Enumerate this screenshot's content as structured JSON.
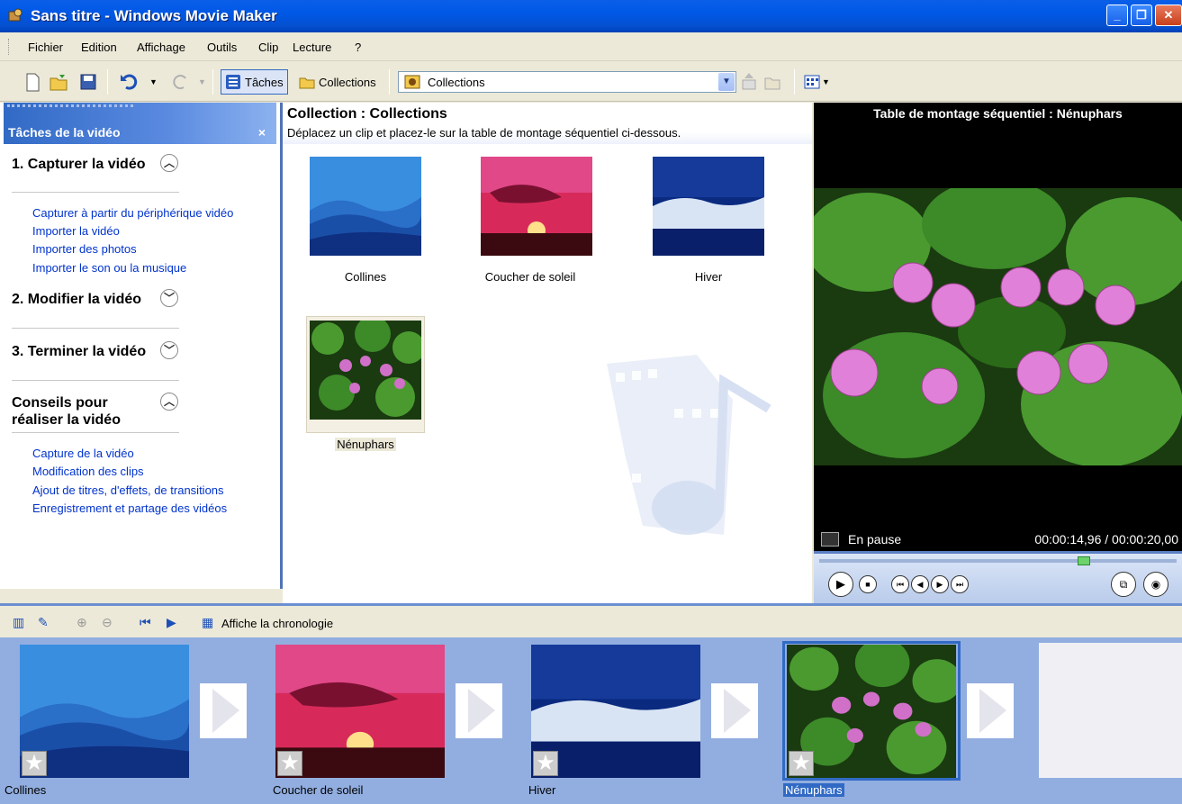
{
  "window": {
    "title": "Sans titre - Windows Movie Maker"
  },
  "menu": [
    "Fichier",
    "Edition",
    "Affichage",
    "Outils",
    "Clip",
    "Lecture",
    "?"
  ],
  "toolbar": {
    "tasks_label": "Tâches",
    "collections_label": "Collections",
    "combo_value": "Collections"
  },
  "tasks": {
    "header": "Tâches de la vidéo",
    "close": "×",
    "sections": [
      {
        "title": "1. Capturer la vidéo",
        "expanded": true,
        "links": [
          "Capturer à partir du périphérique vidéo",
          "Importer la vidéo",
          "Importer des photos",
          "Importer le son ou la musique"
        ]
      },
      {
        "title": "2. Modifier la vidéo",
        "expanded": false,
        "links": []
      },
      {
        "title": "3. Terminer la vidéo",
        "expanded": false,
        "links": []
      },
      {
        "title": "Conseils pour réaliser la vidéo",
        "expanded": true,
        "links": [
          "Capture de la vidéo",
          "Modification des clips",
          "Ajout de titres, d'effets, de transitions",
          "Enregistrement et partage des vidéos"
        ]
      }
    ]
  },
  "collection": {
    "title": "Collection : Collections",
    "subtitle": "Déplacez un clip et placez-le sur la table de montage séquentiel ci-dessous.",
    "clips": [
      "Collines",
      "Coucher de soleil",
      "Hiver",
      "Nénuphars"
    ],
    "selected": "Nénuphars"
  },
  "preview": {
    "title": "Table de montage séquentiel : Nénuphars",
    "status": "En pause",
    "time": "00:00:14,96 / 00:00:20,00",
    "progress": 0.75
  },
  "storyboard": {
    "toggle_label": "Affiche la chronologie",
    "items": [
      "Collines",
      "Coucher de soleil",
      "Hiver",
      "Nénuphars"
    ],
    "selected": "Nénuphars"
  },
  "colors": {
    "xp_blue": "#0058e6",
    "link": "#0033cc",
    "storyboard_bg": "#92aee0"
  }
}
